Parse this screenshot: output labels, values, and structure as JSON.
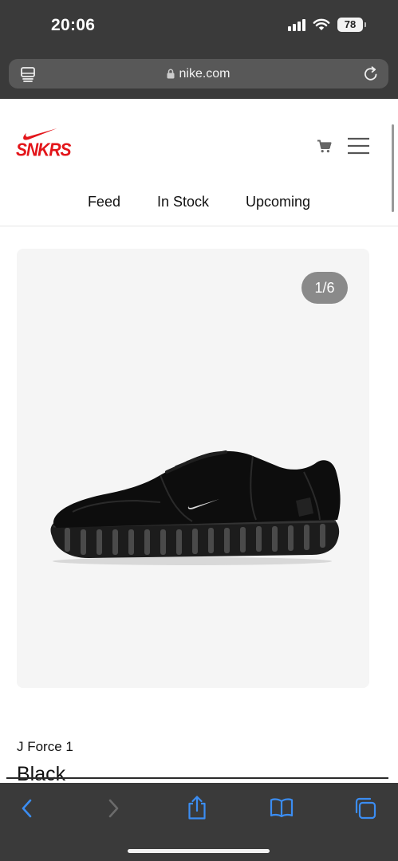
{
  "status_bar": {
    "time": "20:06",
    "battery": "78"
  },
  "browser": {
    "url": "nike.com"
  },
  "site": {
    "logo_text": "SNKRS",
    "brand_color": "#e3151a",
    "tabs": [
      {
        "label": "Feed"
      },
      {
        "label": "In Stock"
      },
      {
        "label": "Upcoming"
      }
    ]
  },
  "product": {
    "image_counter": "1/6",
    "subtitle": "J Force 1",
    "title": "Black"
  },
  "icons": [
    "tab-overview-icon",
    "lock-icon",
    "reload-icon",
    "cart-icon",
    "menu-icon",
    "back-icon",
    "forward-icon",
    "share-icon",
    "bookmarks-icon",
    "tabs-icon"
  ]
}
